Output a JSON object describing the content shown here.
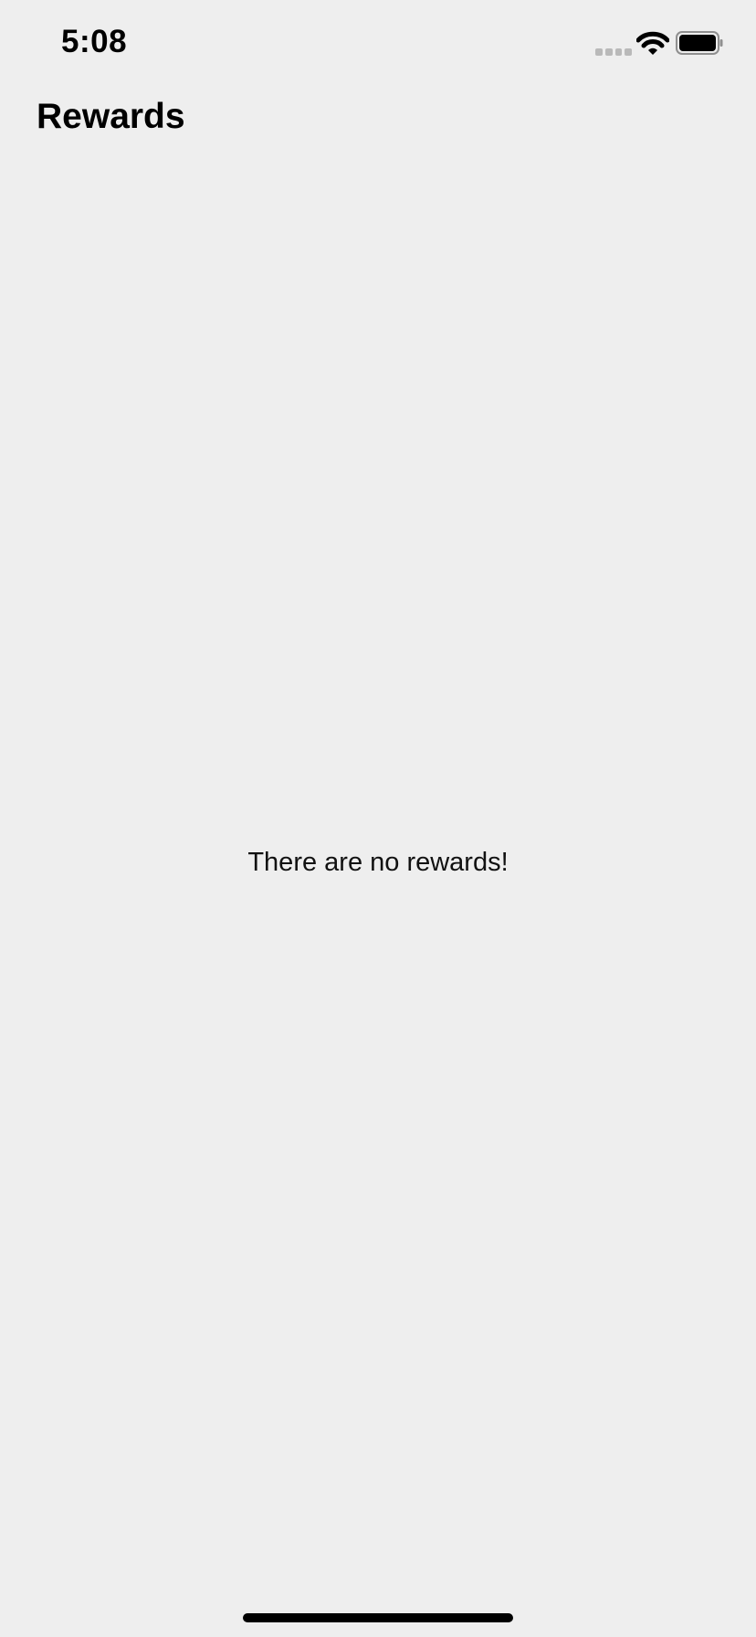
{
  "status_bar": {
    "time": "5:08",
    "signal_icon": "cellular-signal-icon",
    "wifi_icon": "wifi-icon",
    "battery_icon": "battery-icon",
    "battery_level": 1.0
  },
  "header": {
    "title": "Rewards"
  },
  "main": {
    "empty_message": "There are no rewards!"
  },
  "colors": {
    "background": "#eeeeee",
    "text": "#000000",
    "inactive_signal": "#b9b9b9"
  }
}
